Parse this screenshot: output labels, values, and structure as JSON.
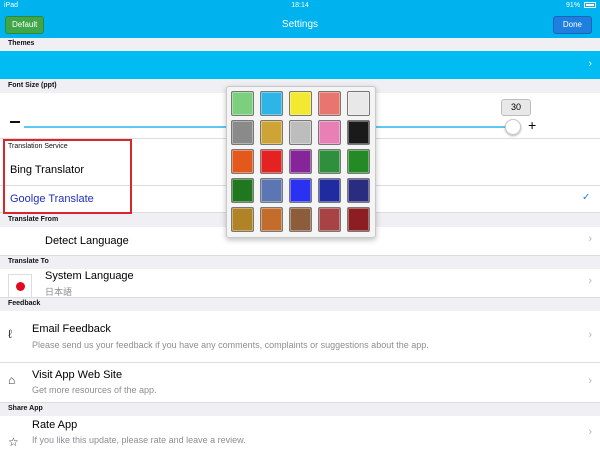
{
  "status_bar": {
    "device": "iPad",
    "time": "18:14",
    "battery": "91%"
  },
  "nav": {
    "title": "Settings",
    "left_button": "Default",
    "right_button": "Done"
  },
  "sections": {
    "themes": "Themes",
    "font_size": "Font Size (ppt)",
    "translation_service": "Translation Service",
    "translate_from": "Translate From",
    "translate_to": "Translate To",
    "feedback": "Feedback",
    "share_app": "Share App"
  },
  "font_size": {
    "value": "30",
    "minus": "–",
    "plus": "+"
  },
  "translation_service": {
    "options": [
      "Bing Translator",
      "Goolge Translate"
    ],
    "selected_index": 1
  },
  "translate_from": {
    "label": "Detect Language"
  },
  "translate_to": {
    "label": "System Language",
    "sub": "日本語"
  },
  "feedback": {
    "email": {
      "title": "Email Feedback",
      "sub": "Please send us your feedback if you have any comments, complaints or suggestions about the app."
    },
    "website": {
      "title": "Visit App Web Site",
      "sub": "Get more resources of the app."
    }
  },
  "share": {
    "rate": {
      "title": "Rate App",
      "sub": "If you like this update, please rate and leave a review."
    }
  },
  "icons": {
    "chevron": "chevron-right-icon",
    "check": "checkmark-icon",
    "ear": "ear-icon",
    "home": "home-icon",
    "star": "star-icon"
  },
  "colors": {
    "theme_color": "#00bcf2",
    "accent": "#1a7fdf",
    "palette": [
      [
        "#7ccf7c",
        "#2eb5e8",
        "#f2e930",
        "#e8766f",
        "#e8e8e8"
      ],
      [
        "#8a8a8a",
        "#cfa436",
        "#bdbdbd",
        "#e87fb5",
        "#1a1a1a"
      ],
      [
        "#e3581b",
        "#e42222",
        "#86259a",
        "#2f8f3c",
        "#238a26"
      ],
      [
        "#20771f",
        "#5c76b4",
        "#2a31f0",
        "#1f2b9e",
        "#2a2c80"
      ],
      [
        "#b08326",
        "#c26d2b",
        "#8d5c3a",
        "#a84345",
        "#8c1d21"
      ]
    ]
  }
}
